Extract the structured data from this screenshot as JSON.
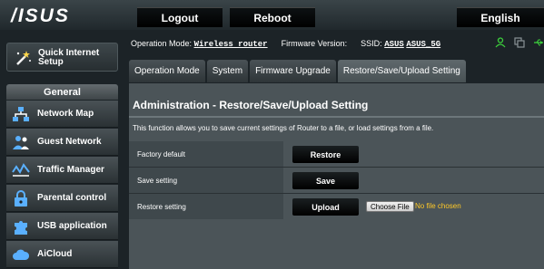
{
  "header": {
    "logo_text": "/ISUS",
    "logout_label": "Logout",
    "reboot_label": "Reboot",
    "language_label": "English"
  },
  "sidebar": {
    "quick_setup_line1": "Quick Internet",
    "quick_setup_line2": "Setup",
    "general_header": "General",
    "items": [
      {
        "label": "Network Map",
        "icon": "network-map-icon"
      },
      {
        "label": "Guest Network",
        "icon": "guest-network-icon"
      },
      {
        "label": "Traffic Manager",
        "icon": "traffic-manager-icon"
      },
      {
        "label": "Parental control",
        "icon": "lock-icon"
      },
      {
        "label": "USB application",
        "icon": "puzzle-icon"
      },
      {
        "label": "AiCloud",
        "icon": "cloud-icon"
      }
    ]
  },
  "status": {
    "op_mode_label": "Operation Mode:",
    "op_mode_value": "Wireless router",
    "firmware_label": "Firmware Version:",
    "ssid_label": "SSID:",
    "ssid_1": "ASUS",
    "ssid_2": "ASUS_5G",
    "icons": [
      "user-icon",
      "copy-icon",
      "usb-icon"
    ],
    "icon_color": "#3cd03c"
  },
  "tabs": [
    {
      "label": "Operation Mode"
    },
    {
      "label": "System"
    },
    {
      "label": "Firmware Upgrade"
    },
    {
      "label": "Restore/Save/Upload Setting"
    }
  ],
  "panel": {
    "title": "Administration - Restore/Save/Upload Setting",
    "description": "This function allows you to save current settings of Router to a file, or load settings from a file.",
    "rows": [
      {
        "label": "Factory default",
        "button": "Restore"
      },
      {
        "label": "Save setting",
        "button": "Save"
      },
      {
        "label": "Restore setting",
        "button": "Upload",
        "file_button": "Choose File",
        "file_status": "No file chosen"
      }
    ]
  }
}
